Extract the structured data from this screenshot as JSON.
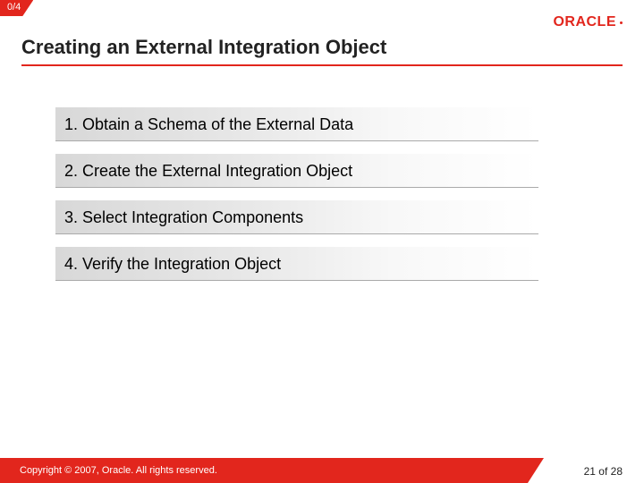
{
  "header": {
    "progress": "0/4",
    "logo_text": "ORACLE"
  },
  "title": "Creating an External Integration Object",
  "steps": [
    "1. Obtain a Schema of the External Data",
    "2. Create the External Integration Object",
    "3. Select Integration Components",
    "4. Verify the Integration Object"
  ],
  "footer": {
    "copyright": "Copyright © 2007, Oracle. All rights reserved.",
    "page_current": "21",
    "page_sep": " of ",
    "page_total": "28"
  }
}
